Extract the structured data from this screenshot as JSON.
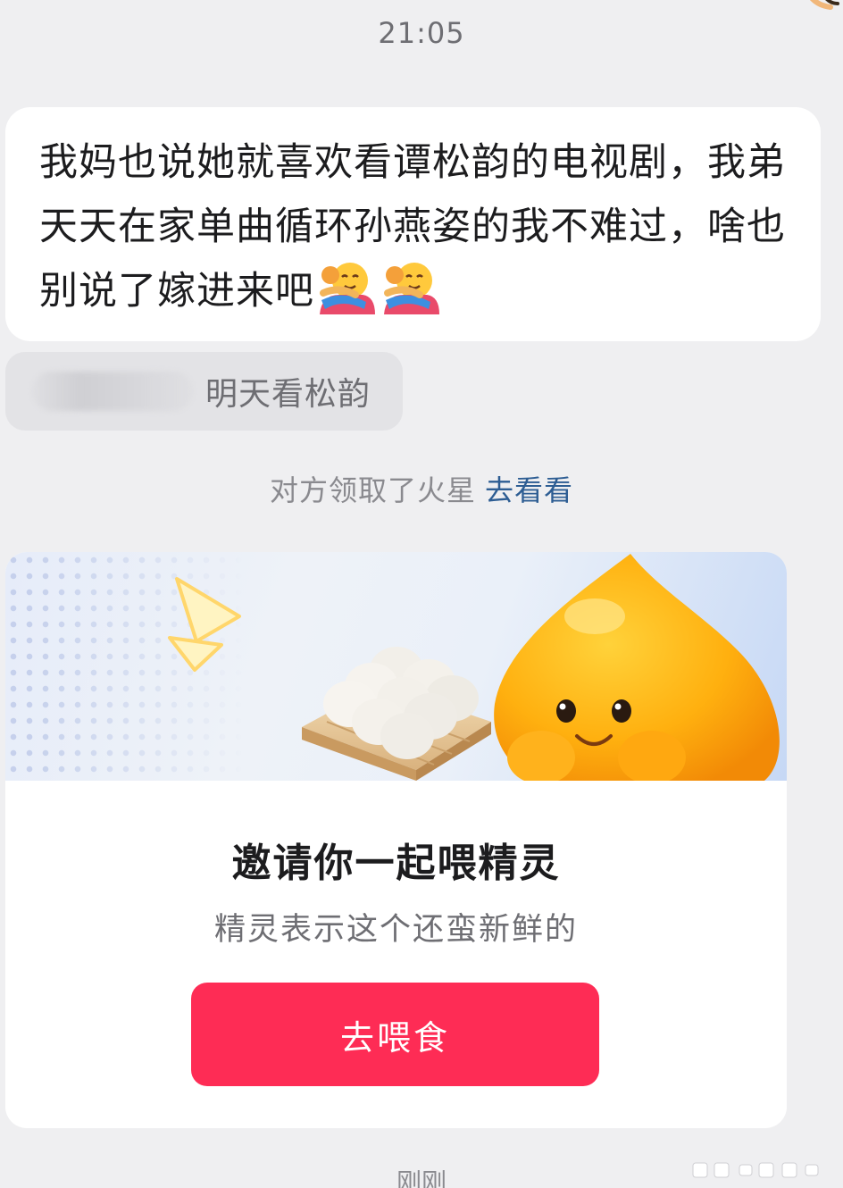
{
  "chat": {
    "timestamp": "21:05",
    "message_text": "我妈也说她就喜欢看谭松韵的电视剧，我弟天天在家单曲循环孙燕姿的我不难过，啥也别说了嫁进来吧",
    "message_emojis": [
      "hugging-emoji",
      "hugging-emoji"
    ],
    "quoted_reply": {
      "text": "明天看松韵"
    },
    "system_notice": {
      "text": "对方领取了火星",
      "link_label": "去看看"
    },
    "invite_card": {
      "title": "邀请你一起喂精灵",
      "subtitle": "精灵表示这个还蛮新鲜的",
      "button_label": "去喂食",
      "accent_color": "#fe2c55"
    },
    "bottom_timestamp": "刚刚"
  }
}
